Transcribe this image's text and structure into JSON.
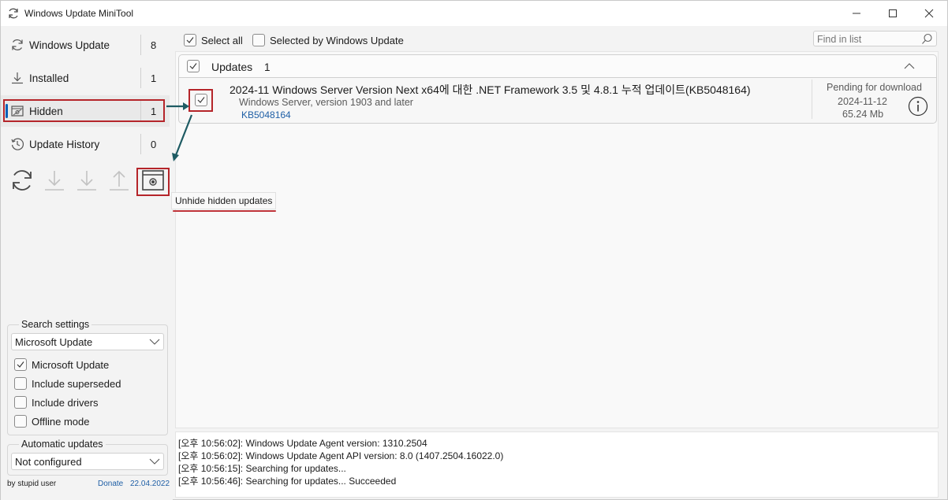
{
  "window": {
    "title": "Windows Update MiniTool"
  },
  "sidebar": {
    "items": [
      {
        "label": "Windows Update",
        "count": "8",
        "icon": "refresh-icon"
      },
      {
        "label": "Installed",
        "count": "1",
        "icon": "download-icon"
      },
      {
        "label": "Hidden",
        "count": "1",
        "icon": "hidden-icon",
        "active": true
      },
      {
        "label": "Update History",
        "count": "0",
        "icon": "history-icon"
      }
    ],
    "toolbar_icons": [
      "refresh-icon",
      "download-icon",
      "install-icon",
      "upload-icon",
      "unhide-icon"
    ],
    "search_settings": {
      "title": "Search settings",
      "source": "Microsoft Update",
      "options": [
        {
          "label": "Microsoft Update",
          "checked": true
        },
        {
          "label": "Include superseded",
          "checked": false
        },
        {
          "label": "Include drivers",
          "checked": false
        },
        {
          "label": "Offline mode",
          "checked": false
        }
      ]
    },
    "automatic_updates": {
      "title": "Automatic updates",
      "value": "Not configured"
    },
    "footer": {
      "author": "by stupid user",
      "donate": "Donate",
      "date": "22.04.2022"
    }
  },
  "main": {
    "select_all": "Select all",
    "selected_by_wu": "Selected by Windows Update",
    "search_placeholder": "Find in list",
    "group": {
      "label": "Updates",
      "count": "1"
    },
    "updates": [
      {
        "title": "2024-11 Windows Server Version Next x64에 대한 .NET Framework 3.5 및 4.8.1 누적 업데이트(KB5048164)",
        "product": "Windows Server, version 1903 and later",
        "kb": "KB5048164",
        "status": "Pending for download",
        "date": "2024-11-12",
        "size": "65.24 Mb",
        "checked": true
      }
    ],
    "tooltip": "Unhide hidden updates"
  },
  "log": [
    "[오후 10:56:02]: Windows Update Agent version: 1310.2504",
    "[오후 10:56:02]: Windows Update Agent API version: 8.0 (1407.2504.16022.0)",
    "[오후 10:56:15]: Searching for updates...",
    "[오후 10:56:46]: Searching for updates... Succeeded"
  ],
  "colors": {
    "accent": "#005fb8",
    "annotation_red": "#b5252a",
    "annotation_arrow": "#1e5b63",
    "link": "#1f5fa6"
  }
}
